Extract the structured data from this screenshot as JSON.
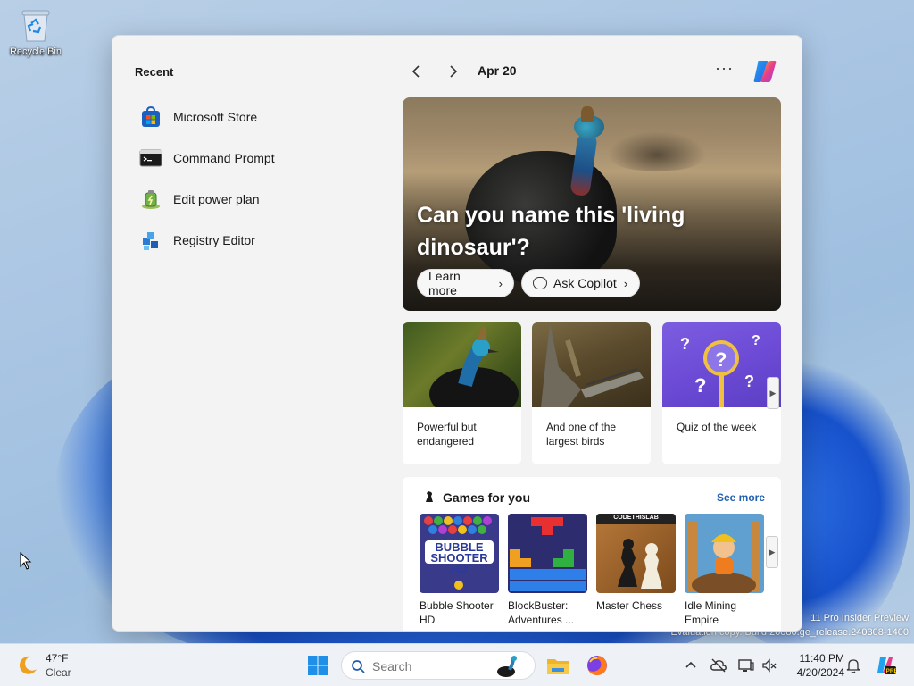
{
  "desktop": {
    "recycle_bin_label": "Recycle Bin",
    "watermark_line1": "11 Pro Insider Preview",
    "watermark_line2": "Evaluation copy. Build 26080.ge_release.240308-1400"
  },
  "widgets": {
    "recent": {
      "title": "Recent",
      "items": [
        {
          "label": "Microsoft Store",
          "icon": "microsoft-store-icon"
        },
        {
          "label": "Command Prompt",
          "icon": "command-prompt-icon"
        },
        {
          "label": "Edit power plan",
          "icon": "power-plan-icon"
        },
        {
          "label": "Registry Editor",
          "icon": "registry-editor-icon"
        }
      ]
    },
    "header": {
      "date": "Apr 20",
      "more_label": "···"
    },
    "hero": {
      "title": "Can you name this 'living dinosaur'?",
      "learn_more": "Learn more",
      "ask_copilot": "Ask Copilot"
    },
    "cards": [
      {
        "caption": "Powerful but endangered"
      },
      {
        "caption": "And one of the largest birds"
      },
      {
        "caption": "Quiz of the week"
      }
    ],
    "games": {
      "title": "Games for you",
      "see_more": "See more",
      "items": [
        {
          "name": "Bubble Shooter HD",
          "tile_text": "BUBBLE SHOOTER HD"
        },
        {
          "name": "BlockBuster: Adventures ...",
          "tile_text": ""
        },
        {
          "name": "Master Chess",
          "tile_text": "CODETHISLAB"
        },
        {
          "name": "Idle Mining Empire",
          "tile_text": ""
        }
      ]
    }
  },
  "taskbar": {
    "weather": {
      "temp": "47°F",
      "condition": "Clear"
    },
    "search_placeholder": "Search",
    "clock": {
      "time": "11:40 PM",
      "date": "4/20/2024"
    }
  },
  "colors": {
    "accent": "#1f5fb0",
    "panel_bg": "#f3f3f3",
    "taskbar_bg": "#eef1f6"
  }
}
